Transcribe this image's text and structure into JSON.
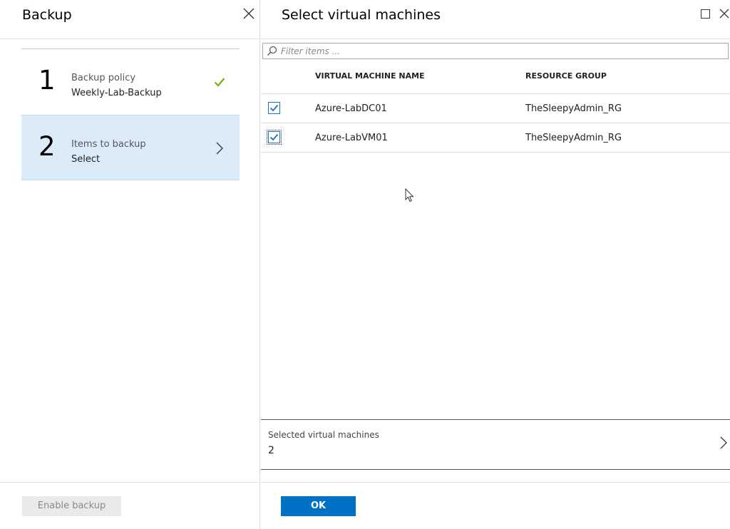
{
  "left_blade": {
    "title": "Backup",
    "steps": [
      {
        "number": "1",
        "label": "Backup policy",
        "value": "Weekly-Lab-Backup",
        "status": "complete"
      },
      {
        "number": "2",
        "label": "Items to backup",
        "value": "Select",
        "status": "active"
      }
    ],
    "enable_button": "Enable backup"
  },
  "right_blade": {
    "title": "Select virtual machines",
    "filter_placeholder": "Filter items ...",
    "columns": {
      "name": "VIRTUAL MACHINE NAME",
      "resource_group": "RESOURCE GROUP"
    },
    "rows": [
      {
        "name": "Azure-LabDC01",
        "resource_group": "TheSleepyAdmin_RG",
        "checked": true
      },
      {
        "name": "Azure-LabVM01",
        "resource_group": "TheSleepyAdmin_RG",
        "checked": true
      }
    ],
    "selected_label": "Selected virtual machines",
    "selected_count": "2",
    "ok_button": "OK"
  },
  "colors": {
    "accent": "#0072c6",
    "active_step_bg": "#dcebf8",
    "check_green": "#6bb700"
  },
  "icons": [
    "close-icon",
    "check-icon",
    "chevron-right-icon",
    "maximize-icon",
    "search-icon",
    "checkbox-checked-icon",
    "mouse-cursor-icon"
  ]
}
